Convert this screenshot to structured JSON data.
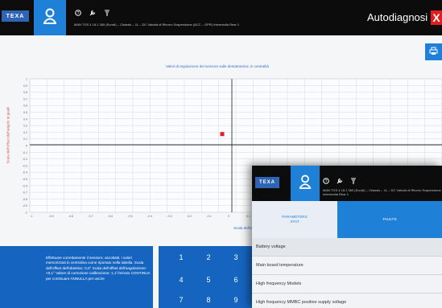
{
  "app": {
    "logo_text": "TEXA",
    "title": "Autodiagnosi",
    "close_label": "X",
    "vehicle_info": "MAN TGS 4 18.1 360 (Euro6) – Chassis – 1L – DC Valvola di Ritorno Sospensione (ACC – GPR)\nIntermedia Rear 1"
  },
  "chart": {
    "title": "Valori di regolazione del sensore sulle dentatrastica: in centralità",
    "ylabel": "Scala dell'offset dell'angolo in gradi",
    "xlabel": "Scala dell'offset dell'angolo in gradi"
  },
  "chart_data": {
    "type": "scatter",
    "title": "Valori di regolazione del sensore sulle dentatrastica: in centralità",
    "xlabel": "Scala dell'offset dell'angolo in gradi",
    "ylabel": "Scala dell'offset dell'angolo in gradi",
    "xlim": [
      -1.0,
      1.0
    ],
    "ylim": [
      -1.0,
      1.0
    ],
    "x_ticks": [
      "-1",
      "-0.9",
      "-0.8",
      "-0.7",
      "-0.6",
      "-0.5",
      "-0.4",
      "-0.3",
      "-0.2",
      "-0.1",
      "0",
      "0.1"
    ],
    "y_ticks": [
      "1",
      "0.9",
      "0.8",
      "0.7",
      "0.6",
      "0.5",
      "0.4",
      "0.3",
      "0.2",
      "0.1",
      "0",
      "-0.1",
      "-0.2",
      "-0.3",
      "-0.4",
      "-0.5",
      "-0.6",
      "-0.7",
      "-0.8",
      "-0.9",
      "-1"
    ],
    "grid": true,
    "points": [
      {
        "x": -0.08,
        "y": 0.07
      }
    ],
    "point_color": "#e02020"
  },
  "instructions": {
    "text": "Effettuare correttamente il sensore; ascoltatti, i valori memorizzati in centralina come riportato nella tabella. Scala dell'offset dell'obiettivo: 0,0° Scala dell'offset dell'angolazione: <0,1° Valore di correzione calibrazione: 1,1°/minuto CONTINUA per continuare ANNULLA per uscire"
  },
  "keypad": {
    "keys": [
      "1",
      "2",
      "3",
      "4",
      "5",
      "6",
      "7",
      "8",
      "9"
    ]
  },
  "sub_window": {
    "logo_text": "TEXA",
    "vehicle_info": "MAN TGS 4 18.1 360 (Euro6) – Chassis – 1L – DC Valvola di Ritorno Sospensione\nIntermedia Rear 1",
    "tabs": [
      {
        "label": "PARAMETERS",
        "sub": "STAT"
      },
      {
        "label": "FAULTS",
        "sub": ""
      }
    ],
    "rows": [
      "Battery voltage",
      "Main board temperature",
      "High frequency Models",
      "High frequency MMBC positive supply voltage"
    ]
  },
  "colors": {
    "accent": "#1f80d8",
    "topbar": "#0c0c0c",
    "close": "#e01e1e",
    "panel": "#1565c0"
  }
}
